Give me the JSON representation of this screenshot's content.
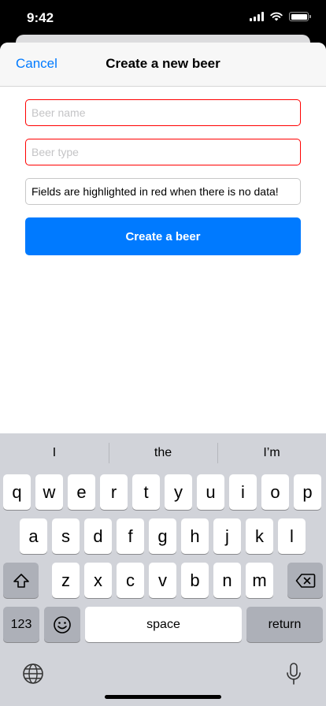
{
  "status_bar": {
    "time": "9:42"
  },
  "nav": {
    "cancel_label": "Cancel",
    "title": "Create a new beer"
  },
  "form": {
    "name_placeholder": "Beer name",
    "type_placeholder": "Beer type",
    "note_value": "Fields are highlighted in red when there is no data!",
    "submit_label": "Create a beer"
  },
  "colors": {
    "accent": "#007aff",
    "error_border": "#ff0000"
  },
  "keyboard": {
    "suggestions": [
      "I",
      "the",
      "I’m"
    ],
    "row1": [
      "q",
      "w",
      "e",
      "r",
      "t",
      "y",
      "u",
      "i",
      "o",
      "p"
    ],
    "row2": [
      "a",
      "s",
      "d",
      "f",
      "g",
      "h",
      "j",
      "k",
      "l"
    ],
    "row3": [
      "z",
      "x",
      "c",
      "v",
      "b",
      "n",
      "m"
    ],
    "numbers_label": "123",
    "space_label": "space",
    "return_label": "return",
    "icons": [
      "shift-icon",
      "backspace-icon",
      "emoji-icon",
      "globe-icon",
      "microphone-icon"
    ]
  }
}
